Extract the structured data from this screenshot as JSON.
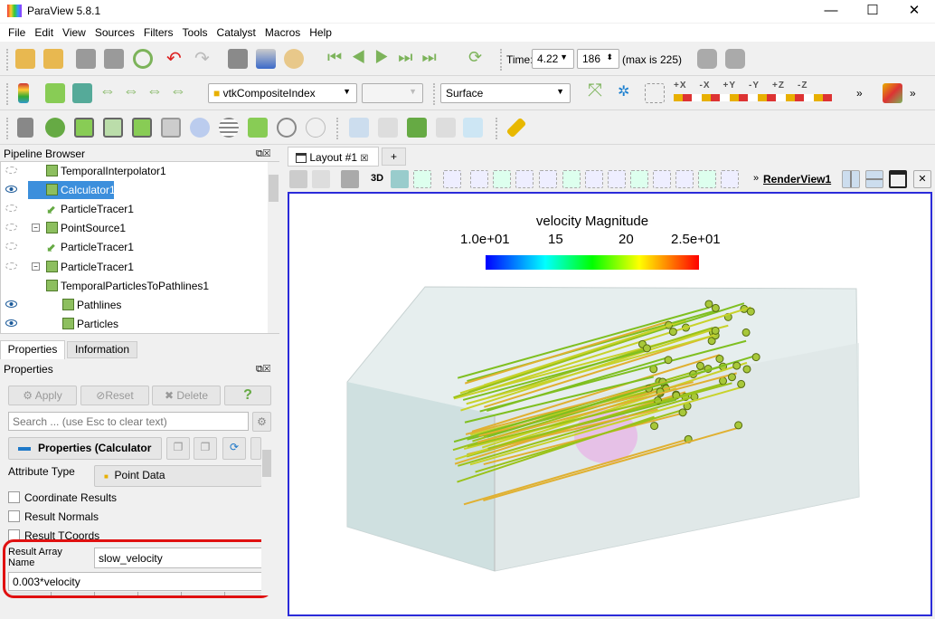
{
  "window": {
    "title": "ParaView 5.8.1",
    "minimize": "—",
    "maximize": "☐",
    "close": "✕"
  },
  "menu": [
    "File",
    "Edit",
    "View",
    "Sources",
    "Filters",
    "Tools",
    "Catalyst",
    "Macros",
    "Help"
  ],
  "time_toolbar": {
    "time_label": "Time:",
    "time_value": "4.22",
    "timestep": "186",
    "max_text": "(max is 225)"
  },
  "display_toolbar": {
    "array_combo": "vtkCompositeIndex",
    "component_combo": "",
    "representation_combo": "Surface",
    "overflow": "»",
    "camera_labels": [
      "+X",
      "-X",
      "+Y",
      "-Y",
      "+Z",
      "-Z"
    ]
  },
  "pipeline": {
    "title": "Pipeline Browser",
    "items": [
      {
        "label": "TemporalInterpolator1",
        "visible": false
      },
      {
        "label": "Calculator1",
        "visible": true,
        "selected": true
      },
      {
        "label": "ParticleTracer1",
        "visible": false
      },
      {
        "label": "PointSource1",
        "visible": false
      },
      {
        "label": "ParticleTracer1",
        "visible": false
      },
      {
        "label": "ParticleTracer1",
        "visible": false
      },
      {
        "label": "TemporalParticlesToPathlines1",
        "visible": false
      },
      {
        "label": "Pathlines",
        "visible": true
      },
      {
        "label": "Particles",
        "visible": true
      }
    ]
  },
  "properties": {
    "tabs": [
      "Properties",
      "Information"
    ],
    "title": "Properties",
    "apply": "Apply",
    "reset": "Reset",
    "delete": "Delete",
    "help": "?",
    "search_placeholder": "Search ... (use Esc to clear text)",
    "section": "Properties (Calculator",
    "attribute_type_label": "Attribute Type",
    "attribute_type_value": "Point Data",
    "checkboxes": [
      "Coordinate Results",
      "Result Normals",
      "Result TCoords"
    ],
    "result_array_label": "Result Array Name",
    "result_array_value": "slow_velocity",
    "expression": "0.003*velocity",
    "highlight_color": "#e01010"
  },
  "layout": {
    "tab": "Layout #1",
    "add_tab": "+",
    "view_name": "RenderView1",
    "three_d": "3D",
    "overflow": "»"
  },
  "colorbar": {
    "title": "velocity Magnitude",
    "labels": [
      "1.0e+01",
      "15",
      "20",
      "2.5e+01"
    ],
    "range": [
      10,
      25
    ]
  },
  "colors": {
    "accent": "#0a64d8",
    "selection": "#3c8fdc",
    "view_border": "#2b2bd9"
  }
}
